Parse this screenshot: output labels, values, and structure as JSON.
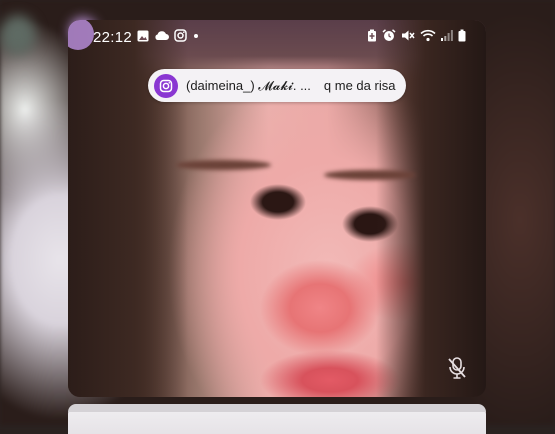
{
  "status_bar": {
    "time": "22:12",
    "left_icons": [
      "image-icon",
      "cloud-icon",
      "instagram-icon",
      "dot-icon"
    ],
    "right_icons": [
      "battery-saver-icon",
      "alarm-icon",
      "mute-icon",
      "wifi-icon",
      "signal-icon",
      "battery-icon"
    ]
  },
  "notification": {
    "app_icon": "instagram-icon",
    "sender": "(daimeina_) 𝓜𝓪𝓴𝓲. ...",
    "message": "q me da risa"
  },
  "call": {
    "mic_icon": "mic-off-icon"
  },
  "colors": {
    "instagram_purple": "#8a37d2",
    "chip_bg": "#f4f2f5"
  }
}
